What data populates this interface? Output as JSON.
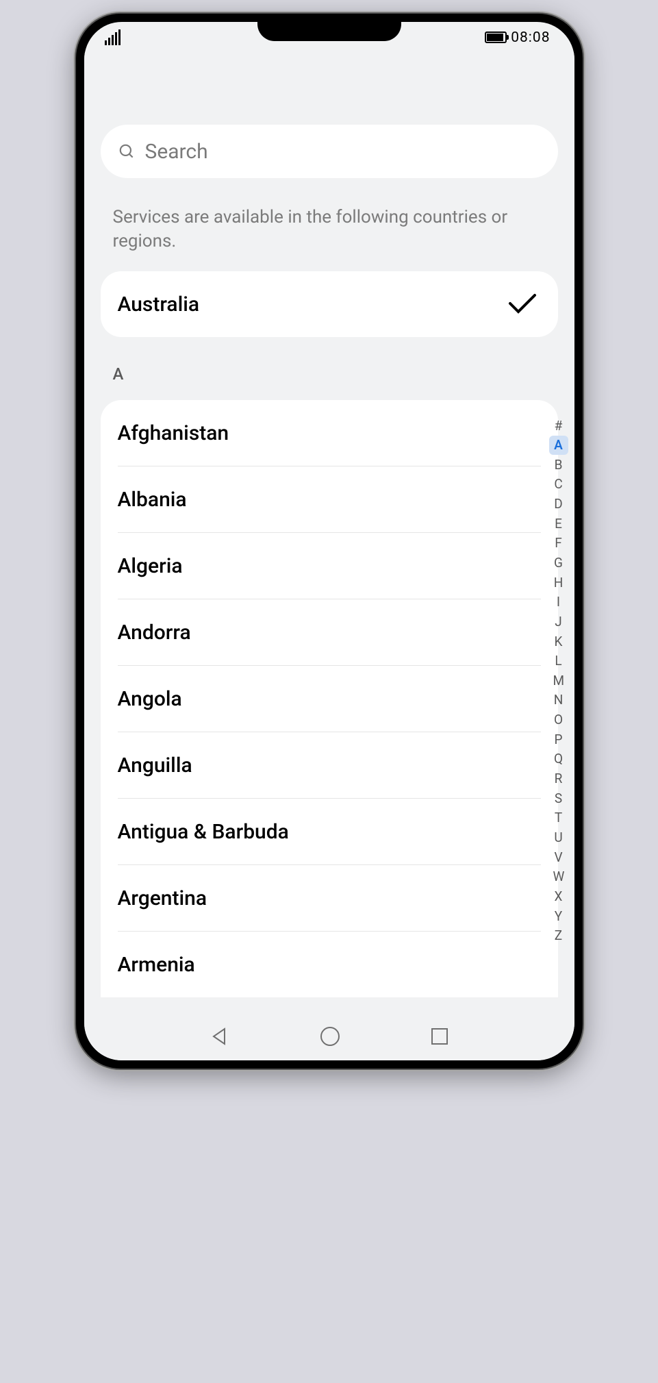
{
  "statusBar": {
    "time": "08:08"
  },
  "search": {
    "placeholder": "Search"
  },
  "description": "Services are available in the following countries or regions.",
  "selected": {
    "name": "Australia"
  },
  "sectionLetter": "A",
  "countries": [
    {
      "name": "Afghanistan"
    },
    {
      "name": "Albania"
    },
    {
      "name": "Algeria"
    },
    {
      "name": "Andorra"
    },
    {
      "name": "Angola"
    },
    {
      "name": "Anguilla"
    },
    {
      "name": "Antigua & Barbuda"
    },
    {
      "name": "Argentina"
    },
    {
      "name": "Armenia"
    }
  ],
  "alphaIndex": {
    "activeLetter": "A",
    "letters": [
      "#",
      "A",
      "B",
      "C",
      "D",
      "E",
      "F",
      "G",
      "H",
      "I",
      "J",
      "K",
      "L",
      "M",
      "N",
      "O",
      "P",
      "Q",
      "R",
      "S",
      "T",
      "U",
      "V",
      "W",
      "X",
      "Y",
      "Z"
    ]
  }
}
